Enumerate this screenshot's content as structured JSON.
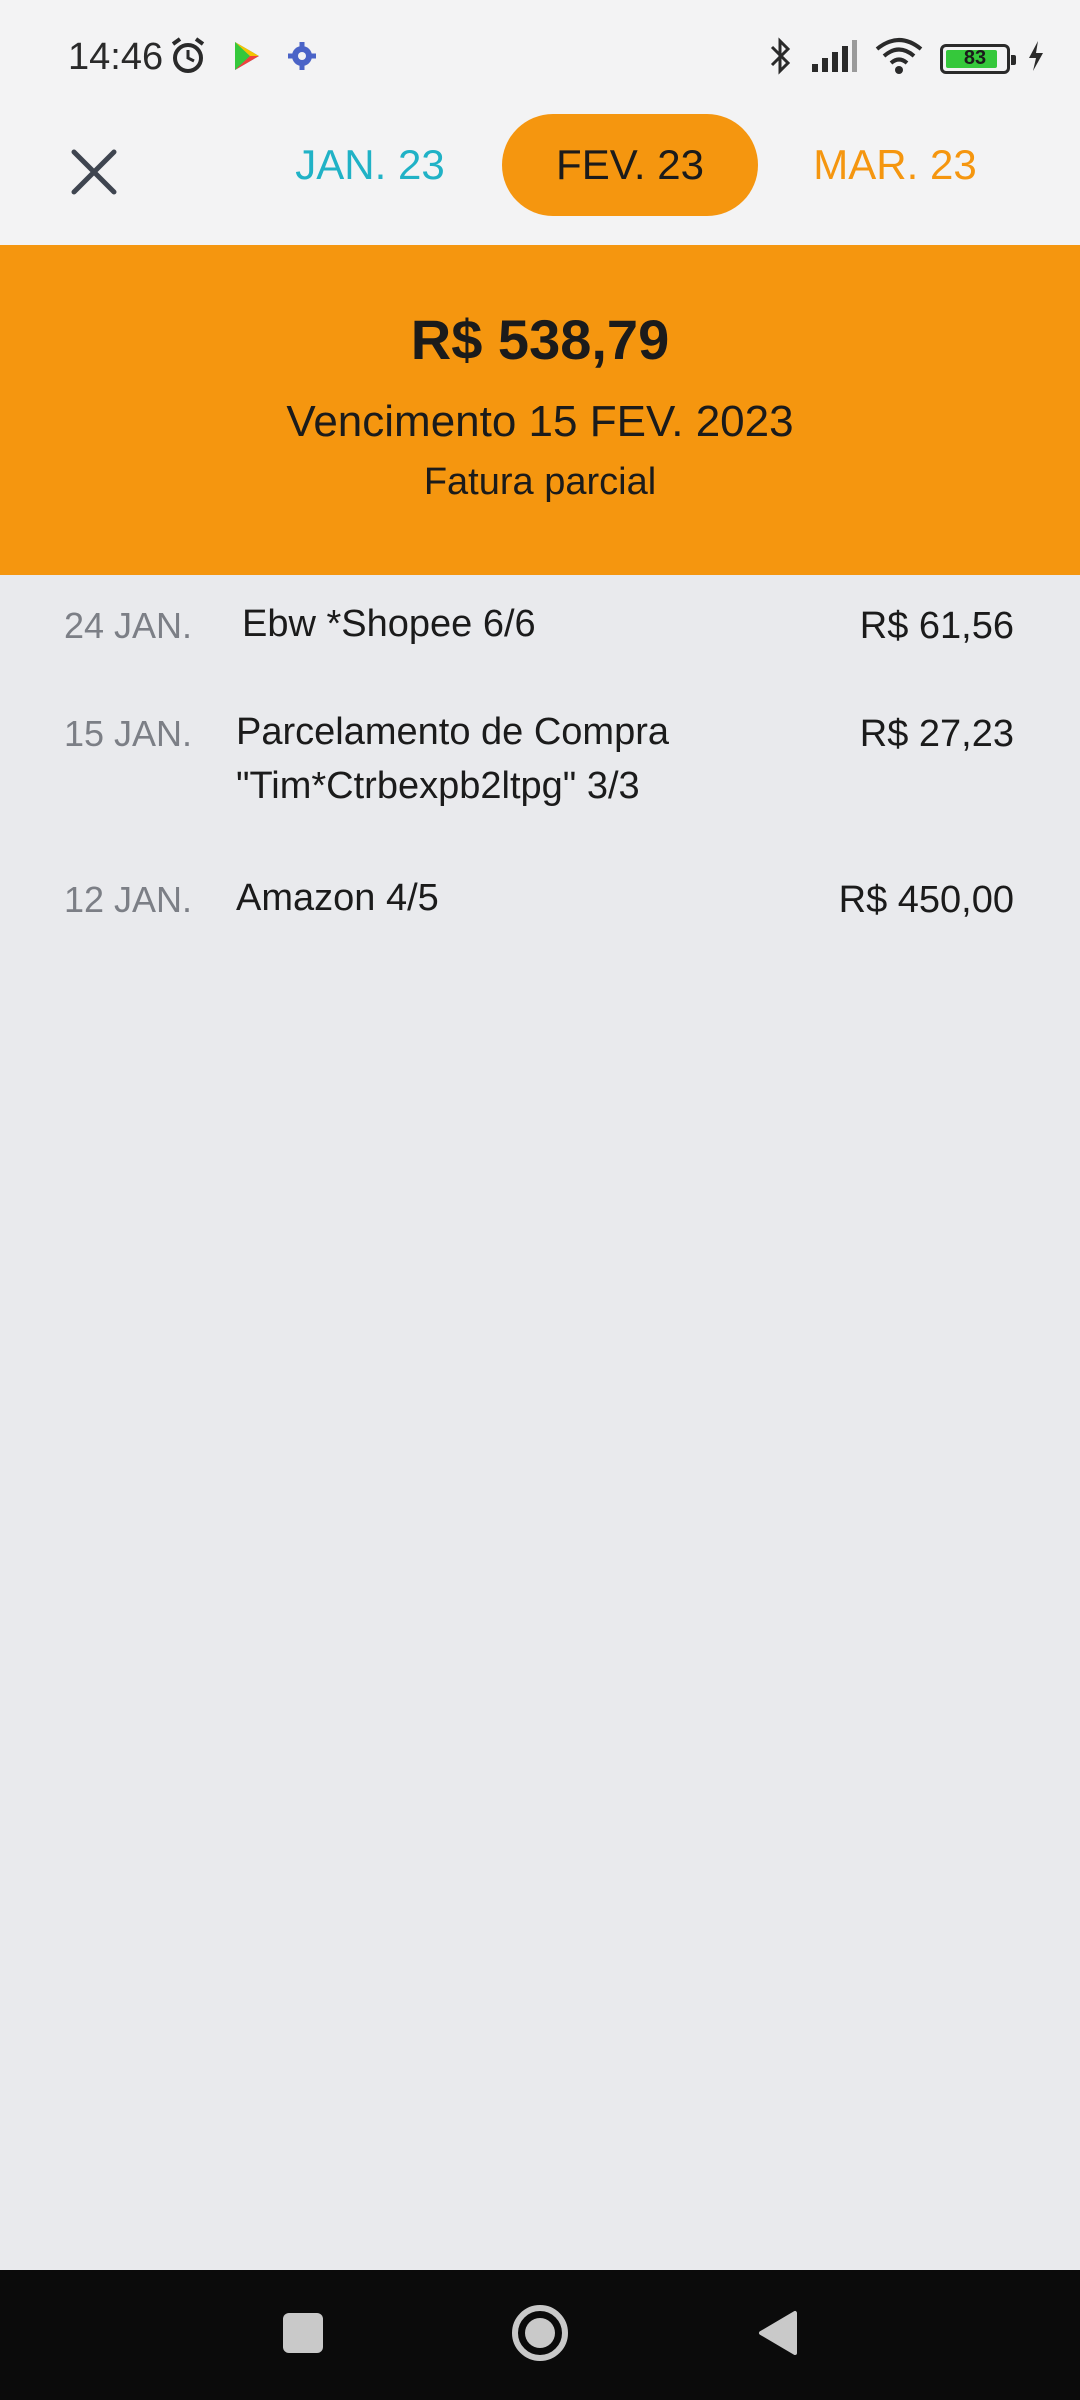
{
  "status_bar": {
    "time": "14:46",
    "battery_level": "83",
    "icons": [
      "alarm-icon",
      "play-store-icon",
      "settings-icon",
      "bluetooth-icon",
      "signal-icon",
      "wifi-icon",
      "battery-icon",
      "charging-icon"
    ]
  },
  "nav": {
    "tabs": [
      {
        "label": "JAN. 23",
        "color": "#20b2c6"
      },
      {
        "label": "FEV. 23",
        "color": "#1b1b1b",
        "selected": true
      },
      {
        "label": "MAR. 23",
        "color": "#f5960f"
      }
    ]
  },
  "summary": {
    "amount": "R$ 538,79",
    "due": "Vencimento 15 FEV. 2023",
    "status": "Fatura parcial",
    "accent": "#f5960f"
  },
  "transactions": [
    {
      "date": "24 JAN.",
      "desc_lines": [
        "Ebw *Shopee 6/6"
      ],
      "amount": "R$ 61,56"
    },
    {
      "date": "15 JAN.",
      "desc_lines": [
        "Parcelamento de Compra",
        "\"Tim*Ctrbexpb2ltpg\" 3/3"
      ],
      "amount": "R$ 27,23"
    },
    {
      "date": "12 JAN.",
      "desc_lines": [
        "Amazon 4/5"
      ],
      "amount": "R$ 450,00"
    }
  ]
}
